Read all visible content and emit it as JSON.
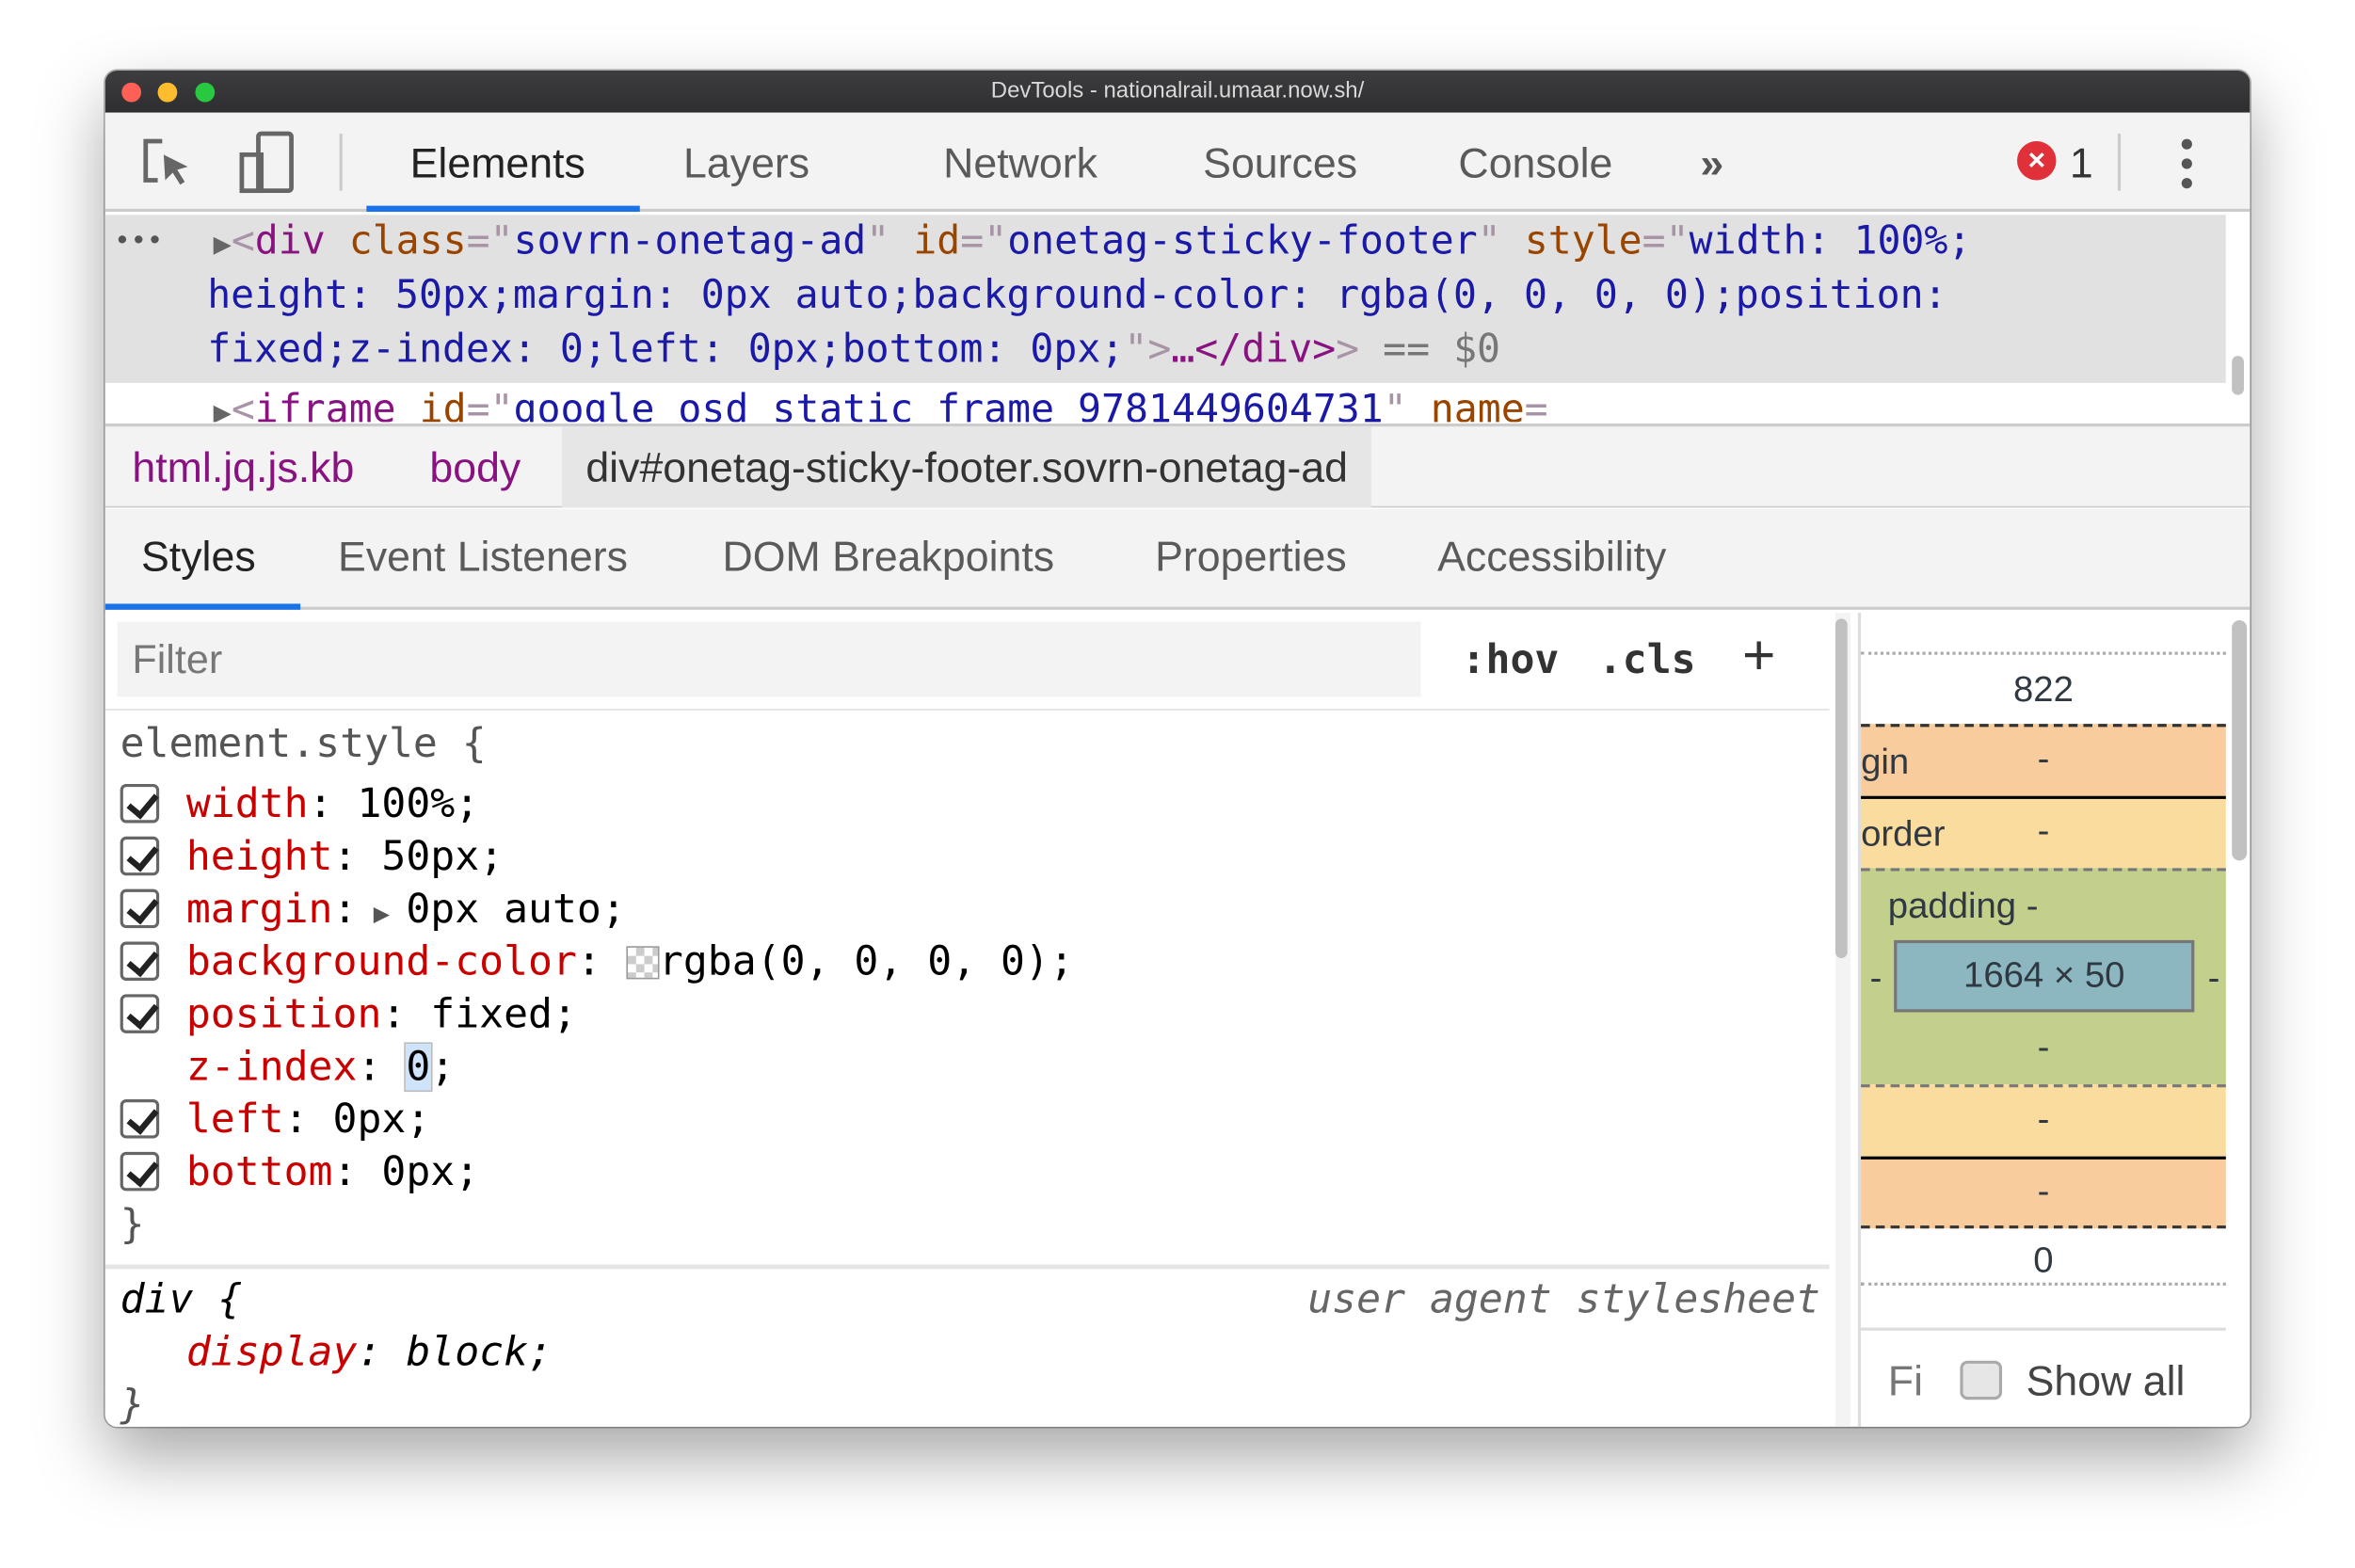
{
  "window": {
    "title": "DevTools - nationalrail.umaar.now.sh/"
  },
  "toolbar": {
    "tabs": [
      "Elements",
      "Layers",
      "Network",
      "Sources",
      "Console"
    ],
    "active_tab": "Elements",
    "more": "»",
    "error_count": "1",
    "accent": "#1a73e8"
  },
  "dom": {
    "ellipsis": "•••",
    "line1": {
      "tag": "div",
      "a1": "class",
      "v1": "sovrn-onetag-ad",
      "a2": "id",
      "v2": "onetag-sticky-footer",
      "a3": "style",
      "v3a": "width: 100%;"
    },
    "line2": "height: 50px;margin: 0px auto;background-color: rgba(0, 0, 0, 0);position:",
    "line3": "fixed;z-index: 0;left: 0px;bottom: 0px;",
    "close": "…</div>",
    "dollar": "== $0",
    "line4": {
      "tag": "iframe",
      "a1": "id",
      "v1": "google_osd_static_frame_9781449604731",
      "a2": "name"
    }
  },
  "breadcrumb": [
    "html.jq.js.kb",
    "body",
    "div#onetag-sticky-footer.sovrn-onetag-ad"
  ],
  "subtabs": [
    "Styles",
    "Event Listeners",
    "DOM Breakpoints",
    "Properties",
    "Accessibility"
  ],
  "styles": {
    "filter_placeholder": "Filter",
    "hov": ":hov",
    "cls": ".cls",
    "plus": "+",
    "selector": "element.style {",
    "props": [
      {
        "name": "width",
        "value": "100%;",
        "checked": true
      },
      {
        "name": "height",
        "value": "50px;",
        "checked": true
      },
      {
        "name": "margin",
        "value": "0px auto;",
        "checked": true
      },
      {
        "name": "background-color",
        "value": "rgba(0, 0, 0, 0);",
        "checked": true
      },
      {
        "name": "position",
        "value": "fixed;",
        "checked": true
      },
      {
        "name": "z-index",
        "value": "0",
        "checked": false
      },
      {
        "name": "left",
        "value": "0px;",
        "checked": true
      },
      {
        "name": "bottom",
        "value": "0px;",
        "checked": true
      }
    ],
    "close": "}",
    "ua_selector": "div {",
    "ua_label": "user agent stylesheet",
    "ua_prop": "display",
    "ua_value": "block;",
    "ua_close": "}"
  },
  "boxmodel": {
    "top": "822",
    "margin_label": "gin",
    "margin": "-",
    "border_label": "order",
    "border": "-",
    "padding_label": "padding -",
    "content": "1664 × 50",
    "padding_left": "-",
    "padding_right": "-",
    "padding_bottom": "-",
    "border_bottom": "-",
    "margin_bottom": "-",
    "bottom": "0",
    "filter_text": "Fi",
    "show_all": "Show all",
    "colors": {
      "margin": "#f9cc9d",
      "border": "#fbdc9f",
      "padding": "#c3d08b",
      "content": "#8cb6c0"
    }
  }
}
